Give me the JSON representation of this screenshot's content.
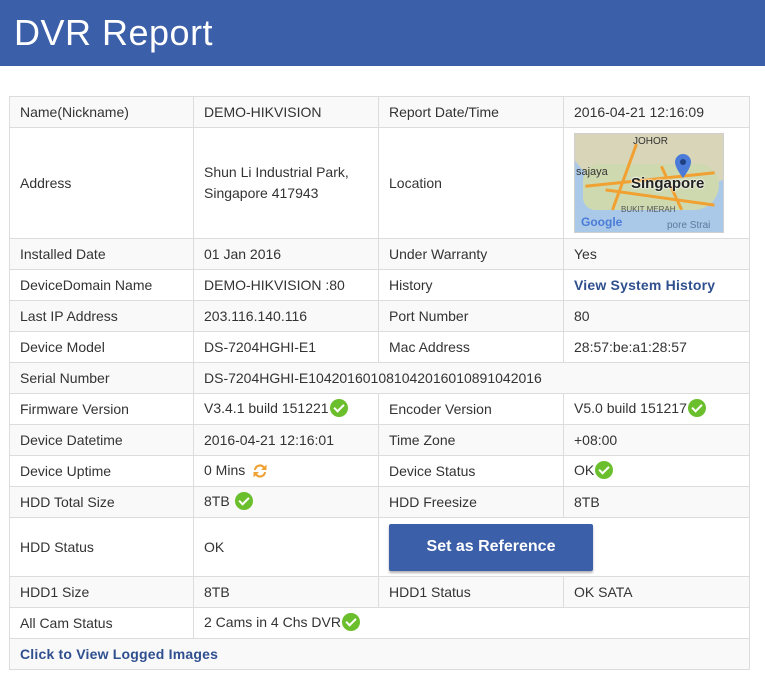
{
  "header": {
    "title": "DVR Report"
  },
  "rows": {
    "name": {
      "label": "Name(Nickname)",
      "value": "DEMO-HIKVISION",
      "label2": "Report Date/Time",
      "value2": "2016-04-21 12:16:09"
    },
    "address": {
      "label": "Address",
      "line1": "Shun Li Industrial Park,",
      "line2": "Singapore 417943",
      "label2": "Location"
    },
    "installed": {
      "label": "Installed Date",
      "value": "01 Jan 2016",
      "label2": "Under Warranty",
      "value2": "Yes"
    },
    "domain": {
      "label": "DeviceDomain Name",
      "value": "DEMO-HIKVISION :80",
      "label2": "History",
      "link2": "View System History"
    },
    "ip": {
      "label": "Last IP Address",
      "value": "203.116.140.116",
      "label2": "Port Number",
      "value2": "80"
    },
    "model": {
      "label": "Device Model",
      "value": "DS-7204HGHI-E1",
      "label2": "Mac Address",
      "value2": "28:57:be:a1:28:57"
    },
    "serial": {
      "label": "Serial Number",
      "value": "DS-7204HGHI-E1042016010810420160108910420​16"
    },
    "firmware": {
      "label": "Firmware Version",
      "value": "V3.4.1 build 151221",
      "label2": "Encoder Version",
      "value2": "V5.0 build 151217"
    },
    "datetime": {
      "label": "Device Datetime",
      "value": "2016-04-21 12:16:01",
      "label2": "Time Zone",
      "value2": "+08:00"
    },
    "uptime": {
      "label": "Device Uptime",
      "value": "0 Mins",
      "label2": "Device Status",
      "value2": "OK"
    },
    "hddtotal": {
      "label": "HDD Total Size",
      "value": "8TB",
      "label2": "HDD Freesize",
      "value2": "8TB"
    },
    "hddstatus": {
      "label": "HDD Status",
      "value": "OK",
      "button": "Set as Reference"
    },
    "hdd1": {
      "label": "HDD1 Size",
      "value": "8TB",
      "label2": "HDD1 Status",
      "value2": "OK SATA"
    },
    "cams": {
      "label": "All Cam Status",
      "value": "2 Cams in 4 Chs DVR"
    },
    "logged": {
      "link": "Click to View Logged Images"
    }
  },
  "map": {
    "city": "Singapore",
    "labels": [
      "JOHOR",
      "sajaya",
      "BUKIT MERAH",
      "pore Strai"
    ],
    "provider": "Google"
  },
  "icons": {
    "check": "check-circle-icon",
    "refresh": "refresh-icon",
    "pin": "map-pin-icon"
  },
  "colors": {
    "header": "#3b5fa8",
    "link": "#2f4f8f",
    "check": "#6cbf2c",
    "refresh": "#f0a132"
  }
}
